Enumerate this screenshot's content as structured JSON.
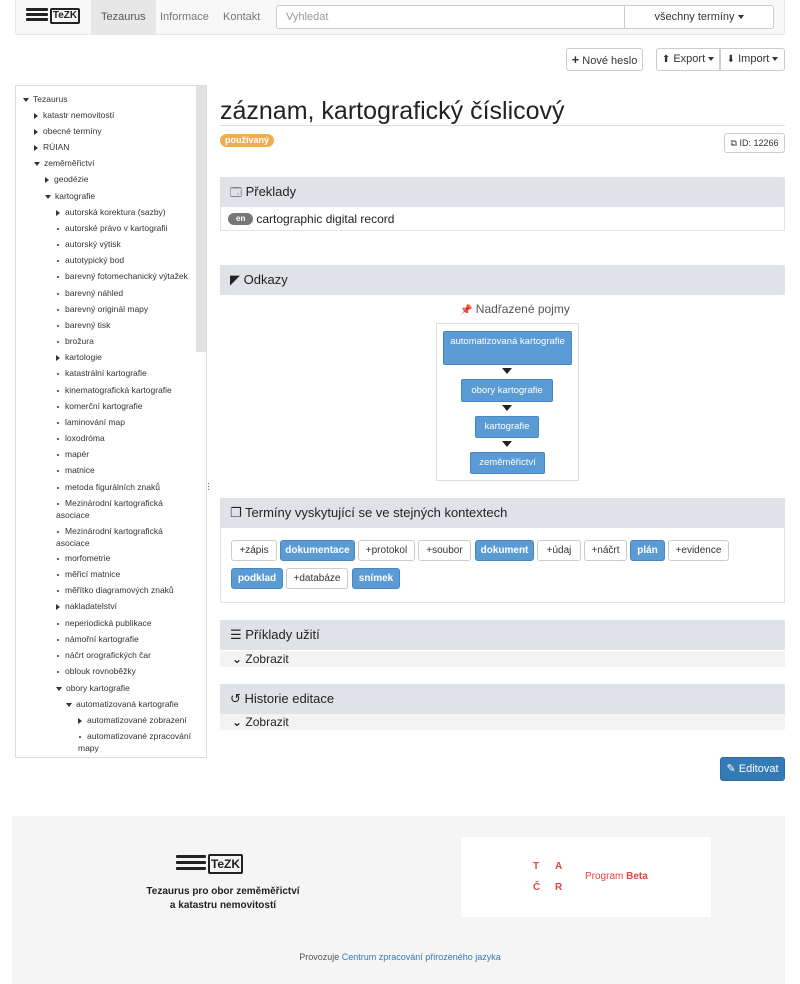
{
  "nav": {
    "logo_text": "TeZK",
    "tabs": [
      "Tezaurus",
      "Informace",
      "Kontakt"
    ],
    "search_placeholder": "Vyhledat",
    "terms_dropdown": "všechny termíny"
  },
  "toolbar": {
    "new_label": "Nové heslo",
    "export_label": "Export",
    "import_label": "Import"
  },
  "tree": {
    "root": "Tezaurus",
    "items": [
      "katastr nemovitostí",
      "obecné termíny",
      "RÚIAN",
      "zeměměřictví",
      "geodézie",
      "kartografie",
      "autorská korektura (sazby)",
      "autorské právo v kartografii",
      "autorský výtisk",
      "autotypický bod",
      "barevný fotomechanický výtažek",
      "barevný náhled",
      "barevný originál mapy",
      "barevný tisk",
      "brožura",
      "kartologie",
      "katastrální kartografie",
      "kinematografická kartografie",
      "komerční kartografie",
      "laminování map",
      "loxodróma",
      "mapér",
      "matnice",
      "metoda figurálních znaků",
      "Mezinárodní kartografická asociace",
      "Mezinárodní kartografická asociace",
      "morfometrie",
      "měřicí matnice",
      "měřítko diagramových znaků",
      "nakladatelství",
      "neperiodická publikace",
      "námořní kartografie",
      "náčrt orografických čar",
      "oblouk rovnoběžky",
      "obory kartografie",
      "automatizovaná kartografie",
      "automatizované zobrazení",
      "automatizované zpracování mapy"
    ]
  },
  "entry": {
    "title": "záznam, kartografický číslicový",
    "status": "používaný",
    "id_label": "ID: 12266"
  },
  "translations": {
    "heading": "Překlady",
    "lang": "en",
    "text": "cartographic digital record"
  },
  "links": {
    "heading": "Odkazy",
    "parents_label": "Nadřazené pojmy",
    "hierarchy": [
      "automatizovaná kartografie",
      "obory kartografie",
      "kartografie",
      "zeměměřictví"
    ]
  },
  "context_terms": {
    "heading": "Termíny vyskytující se ve stejných kontextech",
    "tags": [
      {
        "label": "+zápis",
        "active": false
      },
      {
        "label": "dokumentace",
        "active": true
      },
      {
        "label": "+protokol",
        "active": false
      },
      {
        "label": "+soubor",
        "active": false
      },
      {
        "label": "dokument",
        "active": true
      },
      {
        "label": "+údaj",
        "active": false
      },
      {
        "label": "+náčrt",
        "active": false
      },
      {
        "label": "plán",
        "active": true
      },
      {
        "label": "+evidence",
        "active": false
      },
      {
        "label": "podklad",
        "active": true
      },
      {
        "label": "+databáze",
        "active": false
      },
      {
        "label": "snímek",
        "active": true
      }
    ]
  },
  "examples": {
    "heading": "Příklady užití",
    "toggle": "Zobrazit"
  },
  "history": {
    "heading": "Historie editace",
    "toggle": "Zobrazit"
  },
  "edit_label": "Editovat",
  "footer": {
    "logo_text": "TeZK",
    "title_line1": "Tezaurus pro obor zeměměřictví",
    "title_line2": "a katastru nemovitostí",
    "tacr_letters": [
      "T",
      "A",
      "Č",
      "R"
    ],
    "program_label": "Program",
    "beta_label": "Beta",
    "provoz_prefix": "Provozuje",
    "provoz_link": "Centrum zpracování přirozeného jazyka"
  },
  "colors": {
    "accent": "#337ab7",
    "tag_active": "#5b9bd5",
    "status": "#f0ad4e",
    "panel_head": "#dfe3e8",
    "tacr_red": "#e5463f"
  }
}
